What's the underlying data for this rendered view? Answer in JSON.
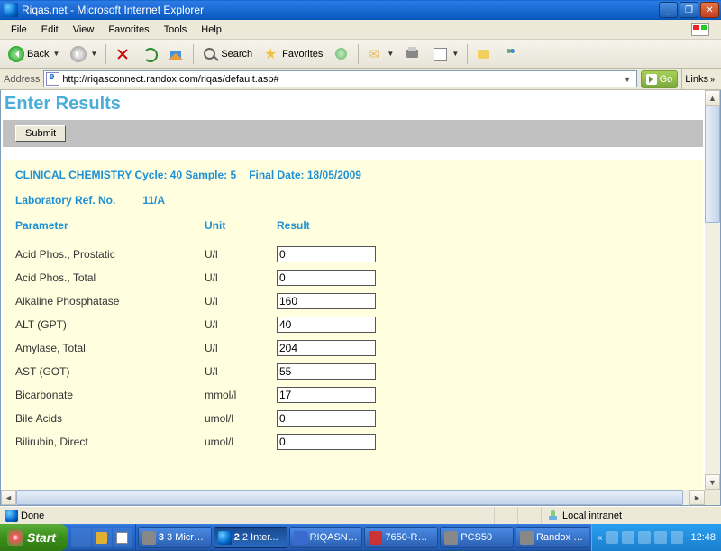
{
  "window": {
    "title": "Riqas.net - Microsoft Internet Explorer"
  },
  "menu": {
    "file": "File",
    "edit": "Edit",
    "view": "View",
    "favorites": "Favorites",
    "tools": "Tools",
    "help": "Help"
  },
  "toolbar": {
    "back": "Back",
    "search": "Search",
    "favorites": "Favorites"
  },
  "address": {
    "label": "Address",
    "url": "http://riqasconnect.randox.com/riqas/default.asp#",
    "go": "Go",
    "links": "Links"
  },
  "page": {
    "title": "Enter Results",
    "submit": "Submit",
    "program_line": "CLINICAL CHEMISTRY Cycle: 40 Sample: 5",
    "final_date_line": "Final Date: 18/05/2009",
    "labref_label": "Laboratory Ref. No.",
    "labref_value": "11/A",
    "columns": {
      "parameter": "Parameter",
      "unit": "Unit",
      "result": "Result"
    },
    "rows": [
      {
        "param": "Acid Phos., Prostatic",
        "unit": "U/l",
        "result": "0"
      },
      {
        "param": "Acid Phos., Total",
        "unit": "U/l",
        "result": "0"
      },
      {
        "param": "Alkaline Phosphatase",
        "unit": "U/l",
        "result": "160"
      },
      {
        "param": "ALT (GPT)",
        "unit": "U/l",
        "result": "40"
      },
      {
        "param": "Amylase, Total",
        "unit": "U/l",
        "result": "204"
      },
      {
        "param": "AST (GOT)",
        "unit": "U/l",
        "result": "55"
      },
      {
        "param": "Bicarbonate",
        "unit": "mmol/l",
        "result": "17"
      },
      {
        "param": "Bile Acids",
        "unit": "umol/l",
        "result": "0"
      },
      {
        "param": "Bilirubin, Direct",
        "unit": "umol/l",
        "result": "0"
      }
    ]
  },
  "status": {
    "done": "Done",
    "zone": "Local intranet"
  },
  "taskbar": {
    "start": "Start",
    "tasks": [
      {
        "label": "3 Micros...",
        "icon": "gen",
        "badge": "3"
      },
      {
        "label": "2 Inter...",
        "icon": "ie",
        "active": true,
        "badge": "2"
      },
      {
        "label": "RIQASNe...",
        "icon": "word"
      },
      {
        "label": "7650-RQ ...",
        "icon": "pdf"
      },
      {
        "label": "PCS50",
        "icon": "gen"
      },
      {
        "label": "Randox In...",
        "icon": "gen"
      }
    ],
    "clock": "12:48"
  }
}
